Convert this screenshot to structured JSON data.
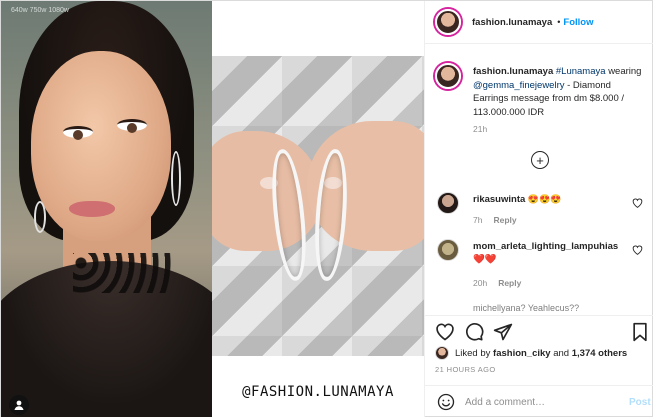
{
  "media": {
    "left_watermark": "640w 750w 1080w",
    "signature": "@FASHION.LUNAMAYA"
  },
  "header": {
    "username": "fashion.lunamaya",
    "dot": "•",
    "follow_label": "Follow"
  },
  "caption": {
    "username": "fashion.lunamaya",
    "hashtag": "#Lunamaya",
    "text_before_mention": "wearing",
    "mention": "@gemma_finejewelry",
    "text_after_mention": "- Diamond Earrings message from dm $8.000 / 113.000.000 IDR",
    "age": "21h"
  },
  "comments": [
    {
      "username": "rikasuwinta",
      "text": "😍😍😍",
      "age": "7h",
      "reply": "Reply"
    },
    {
      "username": "mom_arleta_lighting_lampuhias",
      "text": "❤️❤️",
      "age": "20h",
      "reply": "Reply"
    }
  ],
  "truncated_comment": "michellyana? Yeahlecus??",
  "likes": {
    "text_prefix": "Liked by",
    "liker": "fashion_ciky",
    "text_mid": "and",
    "count": "1,374 others"
  },
  "timestamp": "21 HOURS AGO",
  "add_comment": {
    "placeholder": "Add a comment…",
    "post_label": "Post"
  },
  "colors": {
    "link": "#00376b",
    "follow": "#0095f6",
    "post_disabled": "#b2dffc",
    "secondary": "#8e8e8e"
  }
}
